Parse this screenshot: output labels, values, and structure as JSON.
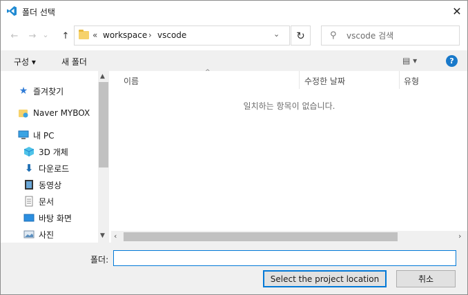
{
  "window": {
    "title": "폴더 선택",
    "close_glyph": "✕"
  },
  "nav": {
    "back": "←",
    "forward": "→",
    "dropdown": "⌄",
    "up": "↑"
  },
  "address": {
    "overflow": "«",
    "crumbs": [
      "workspace",
      "vscode"
    ],
    "separator": "›",
    "dropdown": "⌄",
    "refresh": "↻"
  },
  "search": {
    "placeholder": "vscode 검색",
    "icon": "⚲"
  },
  "commands": {
    "organize": "구성 ▾",
    "new_folder": "새 폴더",
    "view": "▤ ▾",
    "help": "?"
  },
  "sidebar": {
    "items": [
      {
        "label": "즐겨찾기",
        "icon": "star-icon"
      },
      {
        "label": "Naver MYBOX",
        "icon": "cloud-folder-icon"
      },
      {
        "label": "내 PC",
        "icon": "computer-icon"
      },
      {
        "label": "3D 개체",
        "icon": "cube-icon"
      },
      {
        "label": "다운로드",
        "icon": "download-icon"
      },
      {
        "label": "동영상",
        "icon": "video-icon"
      },
      {
        "label": "문서",
        "icon": "document-icon"
      },
      {
        "label": "바탕 화면",
        "icon": "desktop-icon"
      },
      {
        "label": "사진",
        "icon": "pictures-icon"
      }
    ]
  },
  "columns": {
    "name": "이름",
    "modified": "수정한 날짜",
    "type": "유형"
  },
  "empty_message": "일치하는 항목이 없습니다.",
  "footer": {
    "folder_label": "폴더:",
    "folder_value": "",
    "select_button": "Select the project location",
    "cancel_button": "취소"
  },
  "colors": {
    "accent": "#0078d7",
    "chrome": "#f0f0f0",
    "vscode_blue": "#1f8ad2"
  }
}
